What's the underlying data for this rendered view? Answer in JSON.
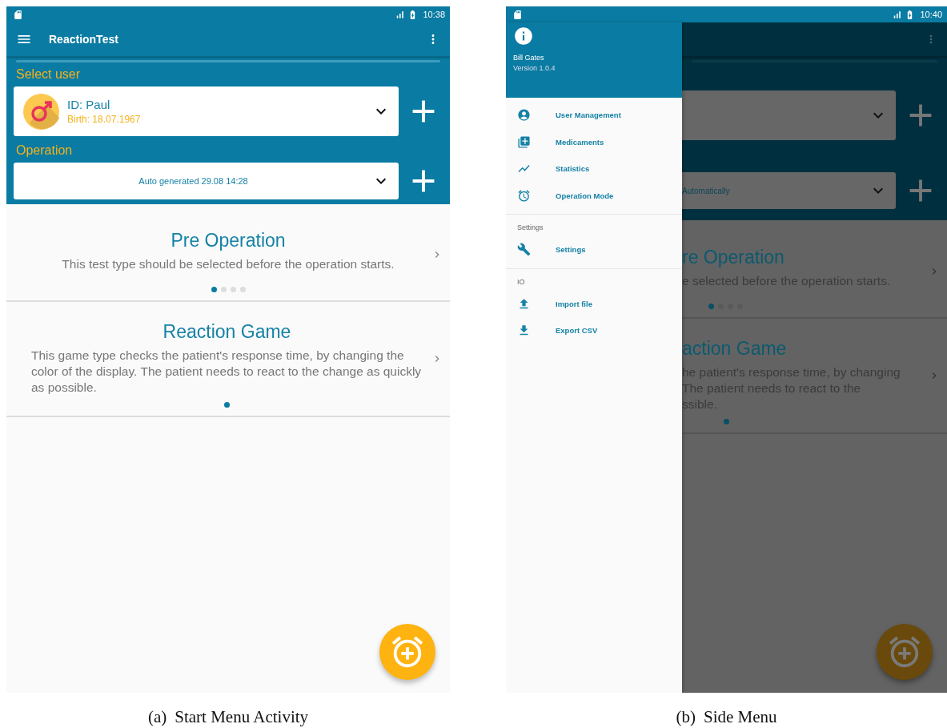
{
  "figures": [
    {
      "label": "(a)",
      "caption": "Start Menu Activity",
      "screen": {
        "status_bar": {
          "time": "10:38"
        },
        "toolbar": {
          "title": "ReactionTest"
        },
        "user_section": {
          "label": "Select user",
          "user": {
            "id": "ID: Paul",
            "birth": "Birth: 18.07.1967"
          }
        },
        "operation_section": {
          "label": "Operation",
          "value": "Auto generated 29.08 14:28"
        },
        "test_types": [
          {
            "title": "Pre Operation",
            "description": "This test type should be selected before the operation starts.",
            "pages": [
              {
                "selected": true
              },
              {
                "selected": false
              },
              {
                "selected": false
              },
              {
                "selected": false
              }
            ]
          },
          {
            "title": "Reaction Game",
            "description": "This game type checks the patient's response time, by changing the color of the display. The patient needs to react to the change as quickly as possible.",
            "pages": [
              {
                "selected": true
              }
            ]
          }
        ]
      }
    },
    {
      "label": "(b)",
      "caption": "Side Menu",
      "screen": {
        "status_bar": {
          "time": "10:40"
        },
        "drawer": {
          "name": "Bill Gates",
          "version": "Version 1.0.4",
          "sections": [
            {
              "items": [
                {
                  "label": "User Management",
                  "kind": "user"
                },
                {
                  "label": "Medicaments",
                  "kind": "library"
                },
                {
                  "label": "Statistics",
                  "kind": "chart"
                },
                {
                  "label": "Operation Mode",
                  "kind": "alarm"
                }
              ]
            },
            {
              "title": "Settings",
              "items": [
                {
                  "label": "Settings",
                  "kind": "wrench"
                }
              ]
            },
            {
              "title": "IO",
              "items": [
                {
                  "label": "Import file",
                  "kind": "upload"
                },
                {
                  "label": "Export CSV",
                  "kind": "download"
                }
              ]
            }
          ]
        },
        "behind": {
          "operation_value": "Automatically",
          "test_types": [
            {
              "title": "re Operation",
              "lines": [
                "e selected before the operation starts."
              ],
              "pages": [
                {
                  "selected": true
                },
                {
                  "selected": false
                },
                {
                  "selected": false
                },
                {
                  "selected": false
                }
              ]
            },
            {
              "title": "action Game",
              "lines": [
                "he patient's response time, by changing",
                "The patient needs to react to the",
                "ssible."
              ],
              "pages": [
                {
                  "selected": true
                }
              ]
            }
          ]
        }
      }
    }
  ]
}
